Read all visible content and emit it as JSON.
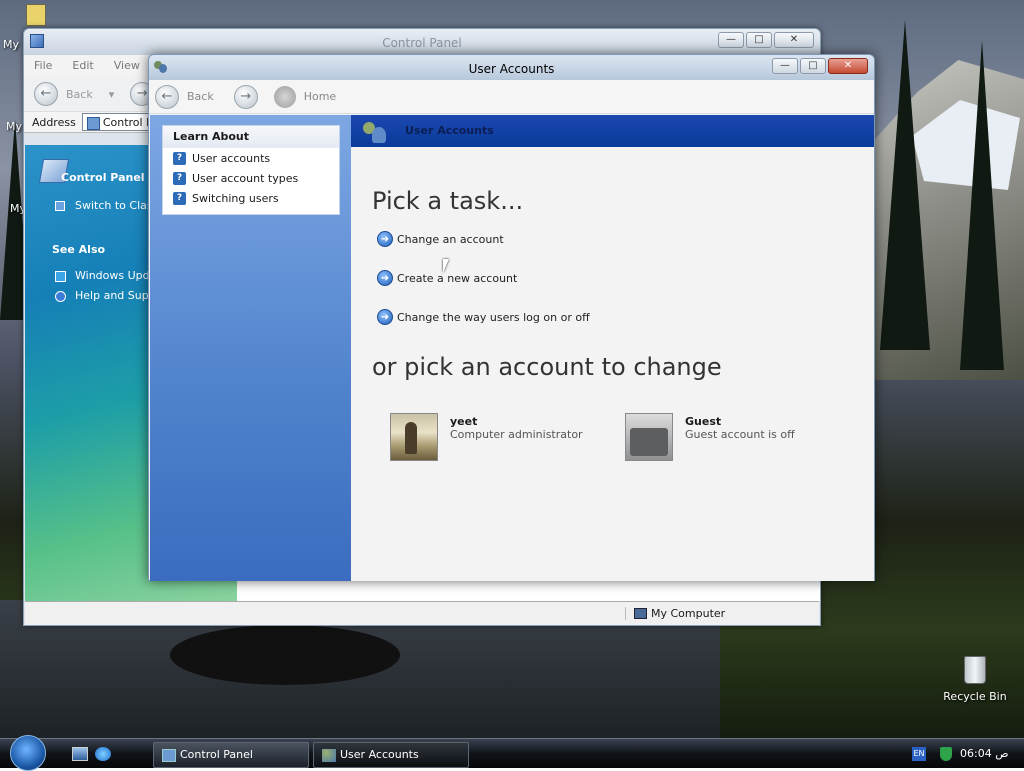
{
  "desktop": {
    "icon1_label": "My",
    "icon2_label": "My",
    "icon3_label": "My",
    "recycle_label": "Recycle Bin"
  },
  "control_panel": {
    "title": "Control Panel",
    "menu": [
      "File",
      "Edit",
      "View",
      "F"
    ],
    "nav_back": "Back",
    "address_label": "Address",
    "address_value": "Control Pa",
    "left_heading": "Control Panel",
    "switch_link": "Switch to Class",
    "see_also": "See Also",
    "links": [
      "Windows Upda",
      "Help and Suppo"
    ],
    "status_location": "My Computer"
  },
  "user_accounts": {
    "title": "User Accounts",
    "nav_back": "Back",
    "nav_home": "Home",
    "learn_heading": "Learn About",
    "learn_items": [
      "User accounts",
      "User account types",
      "Switching users"
    ],
    "band_title": "User Accounts",
    "pick_task": "Pick a task...",
    "tasks": [
      "Change an account",
      "Create a new account",
      "Change the way users log on or off"
    ],
    "pick_account": "or pick an account to change",
    "accounts": [
      {
        "name": "yeet",
        "desc": "Computer administrator",
        "picture": "chess-icon"
      },
      {
        "name": "Guest",
        "desc": "Guest account is off",
        "picture": "briefcase-icon"
      }
    ]
  },
  "taskbar": {
    "buttons": [
      "Control Panel",
      "User Accounts"
    ],
    "language": "EN",
    "clock": "06:04 ص"
  }
}
